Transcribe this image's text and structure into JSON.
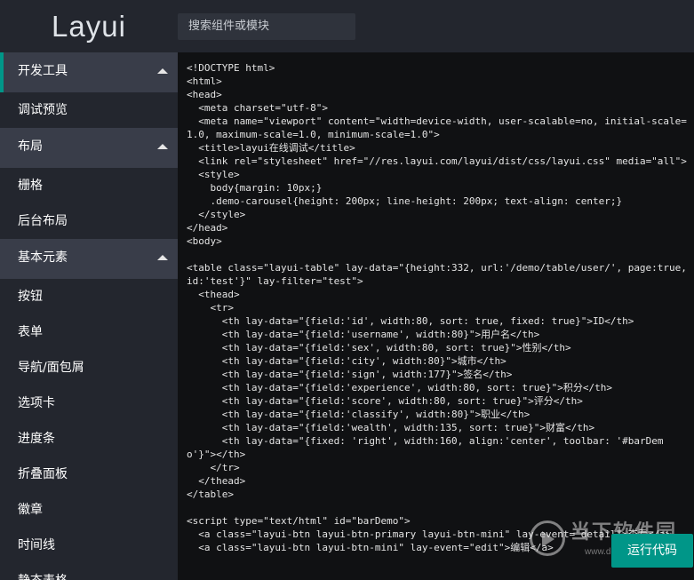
{
  "header": {
    "logo": "Layui",
    "search_placeholder": "搜索组件或模块"
  },
  "sidebar": {
    "groups": [
      {
        "title": "开发工具",
        "items": [
          "调试预览"
        ]
      },
      {
        "title": "布局",
        "items": [
          "栅格",
          "后台布局"
        ]
      },
      {
        "title": "基本元素",
        "items": [
          "按钮",
          "表单",
          "导航/面包屑",
          "选项卡",
          "进度条",
          "折叠面板",
          "徽章",
          "时间线",
          "静态表格"
        ]
      }
    ]
  },
  "editor": {
    "code": "<!DOCTYPE html>\n<html>\n<head>\n  <meta charset=\"utf-8\">\n  <meta name=\"viewport\" content=\"width=device-width, user-scalable=no, initial-scale=1.0, maximum-scale=1.0, minimum-scale=1.0\">\n  <title>layui在线调试</title>\n  <link rel=\"stylesheet\" href=\"//res.layui.com/layui/dist/css/layui.css\" media=\"all\">\n  <style>\n    body{margin: 10px;}\n    .demo-carousel{height: 200px; line-height: 200px; text-align: center;}\n  </style>\n</head>\n<body>\n\n<table class=\"layui-table\" lay-data=\"{height:332, url:'/demo/table/user/', page:true, id:'test'}\" lay-filter=\"test\">\n  <thead>\n    <tr>\n      <th lay-data=\"{field:'id', width:80, sort: true, fixed: true}\">ID</th>\n      <th lay-data=\"{field:'username', width:80}\">用户名</th>\n      <th lay-data=\"{field:'sex', width:80, sort: true}\">性别</th>\n      <th lay-data=\"{field:'city', width:80}\">城市</th>\n      <th lay-data=\"{field:'sign', width:177}\">签名</th>\n      <th lay-data=\"{field:'experience', width:80, sort: true}\">积分</th>\n      <th lay-data=\"{field:'score', width:80, sort: true}\">评分</th>\n      <th lay-data=\"{field:'classify', width:80}\">职业</th>\n      <th lay-data=\"{field:'wealth', width:135, sort: true}\">财富</th>\n      <th lay-data=\"{fixed: 'right', width:160, align:'center', toolbar: '#barDemo'}\"></th>\n    </tr>\n  </thead>\n</table>\n\n<script type=\"text/html\" id=\"barDemo\">\n  <a class=\"layui-btn layui-btn-primary layui-btn-mini\" lay-event=\"detail\">查看</a>\n  <a class=\"layui-btn layui-btn-mini\" lay-event=\"edit\">编辑</a>"
  },
  "run_button": "运行代码",
  "watermark": {
    "text": "当下软件园",
    "url": "www.downxia.com"
  },
  "colors": {
    "accent": "#009688",
    "header_bg": "#23262e",
    "group_bg": "#393d49",
    "editor_bg": "#101113"
  }
}
